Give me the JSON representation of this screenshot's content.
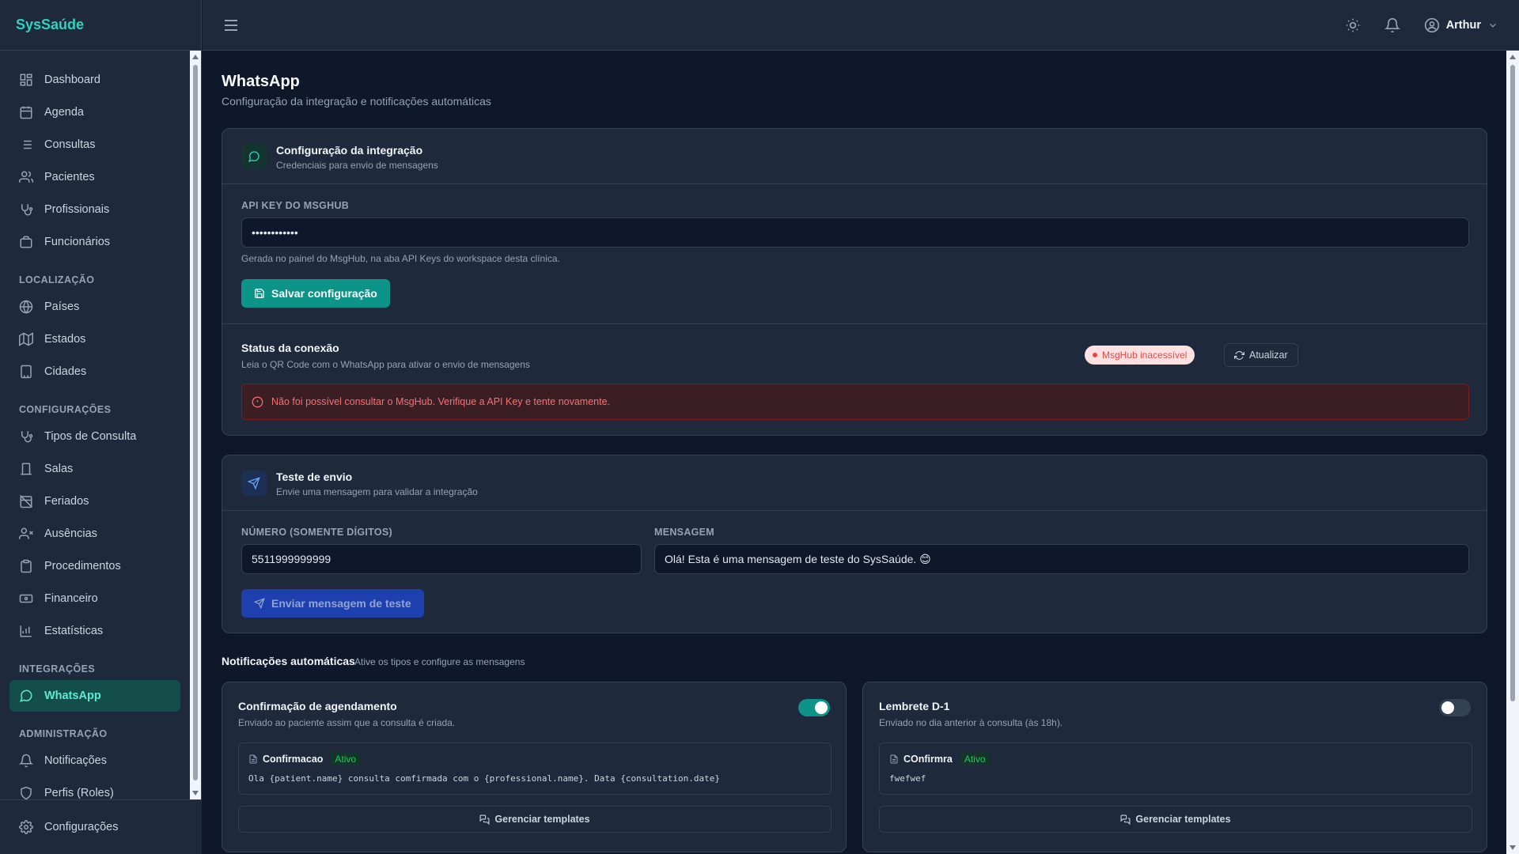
{
  "app": {
    "brand": "SysSaúde"
  },
  "sidebar": {
    "items_main": [
      {
        "label": "Dashboard",
        "icon": "dashboard-icon"
      },
      {
        "label": "Agenda",
        "icon": "calendar-icon"
      },
      {
        "label": "Consultas",
        "icon": "list-icon"
      },
      {
        "label": "Pacientes",
        "icon": "users-icon"
      },
      {
        "label": "Profissionais",
        "icon": "stethoscope-icon"
      },
      {
        "label": "Funcionários",
        "icon": "building-icon"
      }
    ],
    "section_localizacao": "LOCALIZAÇÃO",
    "items_localizacao": [
      {
        "label": "Países",
        "icon": "globe-icon"
      },
      {
        "label": "Estados",
        "icon": "map-icon"
      },
      {
        "label": "Cidades",
        "icon": "city-icon"
      }
    ],
    "section_configuracoes": "CONFIGURAÇÕES",
    "items_configuracoes": [
      {
        "label": "Tipos de Consulta",
        "icon": "stethoscope-icon"
      },
      {
        "label": "Salas",
        "icon": "door-icon"
      },
      {
        "label": "Feriados",
        "icon": "calendar-off-icon"
      },
      {
        "label": "Ausências",
        "icon": "user-x-icon"
      },
      {
        "label": "Procedimentos",
        "icon": "clipboard-icon"
      },
      {
        "label": "Financeiro",
        "icon": "banknote-icon"
      },
      {
        "label": "Estatísticas",
        "icon": "chart-icon"
      }
    ],
    "section_integracoes": "INTEGRAÇÕES",
    "items_integracoes": [
      {
        "label": "WhatsApp",
        "icon": "message-circle-icon",
        "active": true
      }
    ],
    "section_administracao": "ADMINISTRAÇÃO",
    "items_administracao": [
      {
        "label": "Notificações",
        "icon": "bell-icon"
      },
      {
        "label": "Perfis (Roles)",
        "icon": "shield-icon"
      }
    ],
    "footer_label": "Configurações"
  },
  "topbar": {
    "user_name": "Arthur"
  },
  "page": {
    "title": "WhatsApp",
    "subtitle": "Configuração da integração e notificações automáticas"
  },
  "integration": {
    "title": "Configuração da integração",
    "subtitle": "Credenciais para envio de mensagens",
    "api_key_label": "API KEY DO MSGHUB",
    "api_key_value": "••••••••••••",
    "api_key_hint": "Gerada no painel do MsgHub, na aba API Keys do workspace desta clínica.",
    "save_label": "Salvar configuração",
    "status_title": "Status da conexão",
    "status_sub": "Leia o QR Code com o WhatsApp para ativar o envio de mensagens",
    "status_badge": "MsgHub inacessível",
    "refresh_label": "Atualizar",
    "error_text": "Não foi possível consultar o MsgHub. Verifique a API Key e tente novamente."
  },
  "test": {
    "title": "Teste de envio",
    "subtitle": "Envie uma mensagem para validar a integração",
    "number_label": "NÚMERO (SOMENTE DÍGITOS)",
    "number_value": "5511999999999",
    "message_label": "MENSAGEM",
    "message_value": "Olá! Esta é uma mensagem de teste do SysSaúde. 😊",
    "send_label": "Enviar mensagem de teste"
  },
  "notifications": {
    "title": "Notificações automáticas",
    "subtitle": "Ative os tipos e configure as mensagens",
    "cards": [
      {
        "title": "Confirmação de agendamento",
        "subtitle": "Enviado ao paciente assim que a consulta é criada.",
        "enabled": true,
        "template_name": "Confirmacao",
        "template_status": "Ativo",
        "template_body": "Ola {patient.name} consulta comfirmada com o {professional.name}. Data {consultation.date}",
        "manage_label": "Gerenciar templates"
      },
      {
        "title": "Lembrete D-1",
        "subtitle": "Enviado no dia anterior à consulta (às 18h).",
        "enabled": false,
        "template_name": "COnfirmra",
        "template_status": "Ativo",
        "template_body": "fwefwef",
        "manage_label": "Gerenciar templates"
      }
    ]
  },
  "colors": {
    "accent": "#0d9488",
    "brand": "#2dd4bf",
    "danger": "#ef4444",
    "background": "#0f172a",
    "surface": "#1e293b"
  }
}
